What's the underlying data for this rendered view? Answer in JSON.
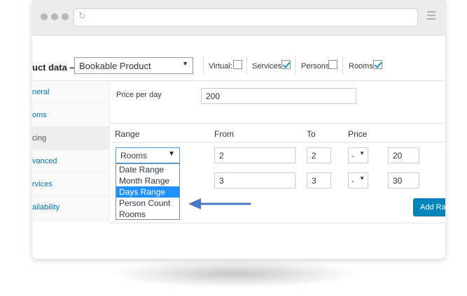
{
  "header": {
    "title": "uct data —",
    "product_type": "Bookable Product",
    "checkboxes": [
      {
        "label": "Virtual:",
        "checked": false
      },
      {
        "label": "Services:",
        "checked": true
      },
      {
        "label": "Persons:",
        "checked": false
      },
      {
        "label": "Rooms:",
        "checked": true
      }
    ]
  },
  "sidebar": {
    "items": [
      {
        "label": "neral",
        "active": false
      },
      {
        "label": "oms",
        "active": false
      },
      {
        "label": "cing",
        "active": true
      },
      {
        "label": "vanced",
        "active": false
      },
      {
        "label": "rvices",
        "active": false
      },
      {
        "label": "ailability",
        "active": false
      }
    ]
  },
  "pricing": {
    "price_per_day_label": "Price per day",
    "price_per_day_value": "200",
    "columns": [
      "Range",
      "From",
      "To",
      "Price"
    ],
    "rows": [
      {
        "range": "Rooms",
        "from": "2",
        "to": "2",
        "op": "-",
        "price": "20"
      },
      {
        "range": "",
        "from": "3",
        "to": "3",
        "op": "-",
        "price": "30"
      }
    ],
    "range_options": [
      "Date Range",
      "Month Range",
      "Days Range",
      "Person Count",
      "Rooms"
    ],
    "highlighted_option": "Days Range",
    "add_button": "Add Ra"
  },
  "colors": {
    "accent": "#0085ba",
    "highlight": "#1e90ff",
    "arrow": "#4a78c2"
  },
  "icons": [
    "reload-icon",
    "menu-icon",
    "chevron-down-icon",
    "arrow-left-icon"
  ]
}
